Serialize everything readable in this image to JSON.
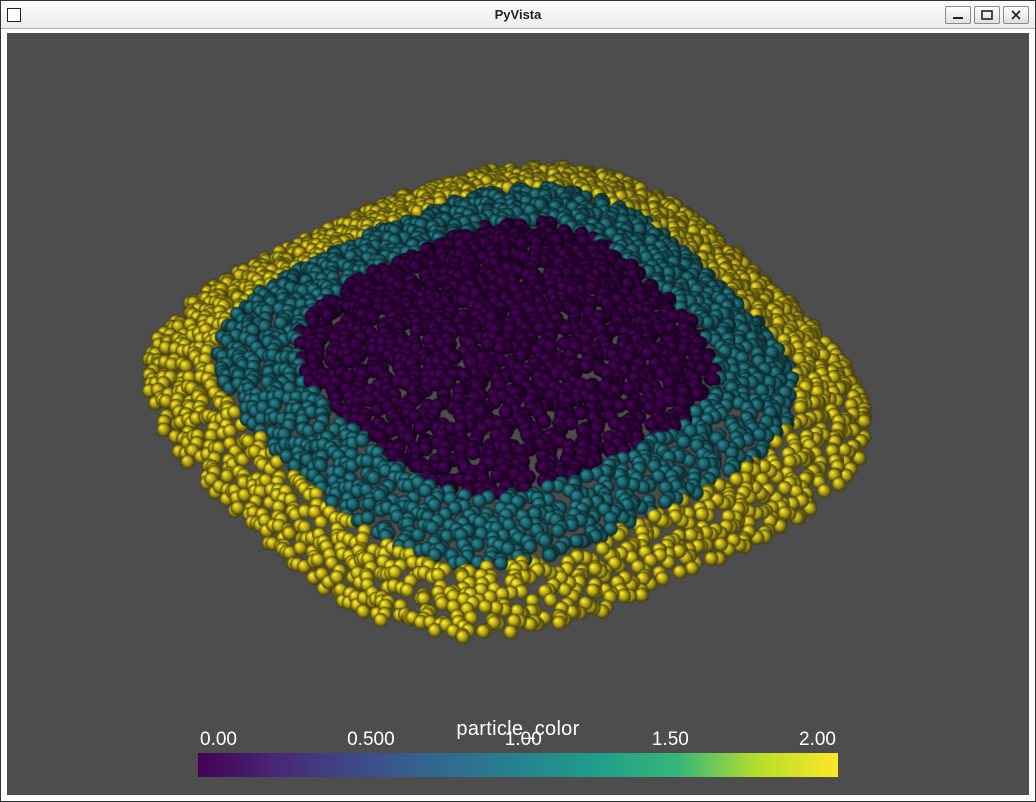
{
  "window": {
    "title": "PyVista",
    "controls": {
      "minimize_tooltip": "Minimize",
      "maximize_tooltip": "Maximize",
      "close_tooltip": "Close"
    }
  },
  "viewport": {
    "background": "#4d4d4d"
  },
  "colorbar": {
    "title": "particle_color",
    "range": [
      0.0,
      2.0
    ],
    "ticks": [
      "0.00",
      "0.500",
      "1.00",
      "1.50",
      "2.00"
    ],
    "colormap": "viridis",
    "stops": [
      {
        "t": 0.0,
        "c": "#440154"
      },
      {
        "t": 0.125,
        "c": "#482878"
      },
      {
        "t": 0.25,
        "c": "#3e4a89"
      },
      {
        "t": 0.375,
        "c": "#31688e"
      },
      {
        "t": 0.5,
        "c": "#26828e"
      },
      {
        "t": 0.625,
        "c": "#1f9e89"
      },
      {
        "t": 0.75,
        "c": "#35b779"
      },
      {
        "t": 0.875,
        "c": "#b5de2b"
      },
      {
        "t": 1.0,
        "c": "#fde725"
      }
    ]
  },
  "chart_data": {
    "type": "scatter",
    "description": "3D point cloud (rendered as spheres) colored by a discrete scalar field 'particle_color'. Three concentric regions on a warped planar sheet, seen from an oblique camera angle.",
    "series_name": "particle_color",
    "value_domain": [
      0.0,
      2.0
    ],
    "classes": [
      {
        "value": 0.0,
        "label": "inner",
        "color": "#440154",
        "approx_fraction": 0.4
      },
      {
        "value": 1.0,
        "label": "middle",
        "color": "#26828e",
        "approx_fraction": 0.3
      },
      {
        "value": 2.0,
        "label": "outer",
        "color": "#fde725",
        "approx_fraction": 0.3
      }
    ],
    "approx_point_count": 3500,
    "camera": {
      "azimuth_deg": -35,
      "elevation_deg": 30
    }
  }
}
